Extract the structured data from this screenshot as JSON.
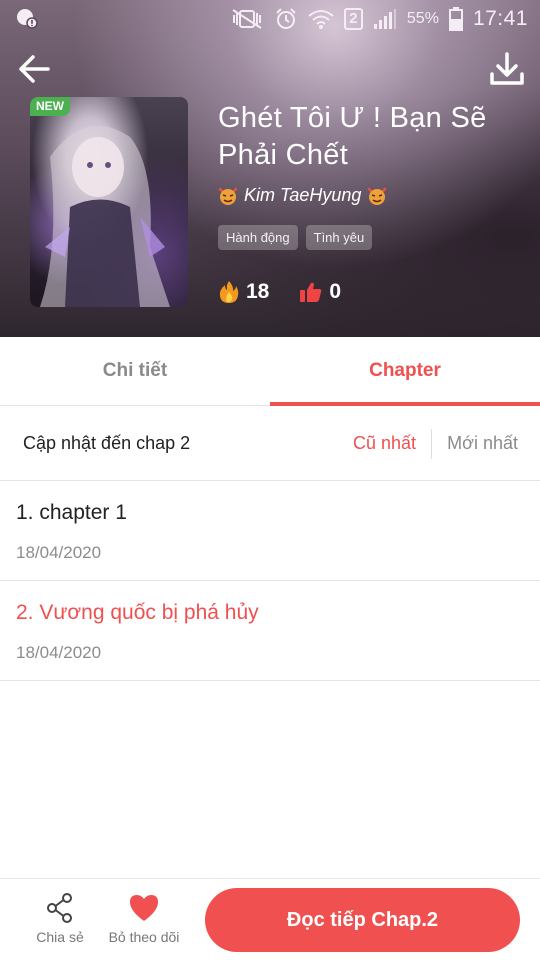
{
  "status_bar": {
    "battery_percent": "55%",
    "time": "17:41",
    "sim_badge": "2"
  },
  "header": {
    "cover_badge": "NEW",
    "title": "Ghét Tôi Ư ! Bạn Sẽ Phải Chết",
    "author": "Kim TaeHyung",
    "tags": [
      "Hành động",
      "Tình yêu"
    ],
    "views": "18",
    "likes": "0"
  },
  "tabs": [
    {
      "label": "Chi tiết",
      "active": false
    },
    {
      "label": "Chapter",
      "active": true
    }
  ],
  "sort": {
    "title": "Cập nhật đến chap 2",
    "oldest_label": "Cũ nhất",
    "newest_label": "Mới nhất"
  },
  "chapters": [
    {
      "name": "1. chapter 1",
      "date": "18/04/2020"
    },
    {
      "name": "2. Vương quốc bị phá hủy",
      "date": "18/04/2020"
    }
  ],
  "bottom_bar": {
    "share_label": "Chia sẻ",
    "unfollow_label": "Bỏ theo dõi",
    "continue_label": "Đọc tiếp Chap.2"
  },
  "colors": {
    "accent": "#f0504f",
    "badge_new": "#4caf50",
    "muted_text": "#8a8a8a"
  }
}
